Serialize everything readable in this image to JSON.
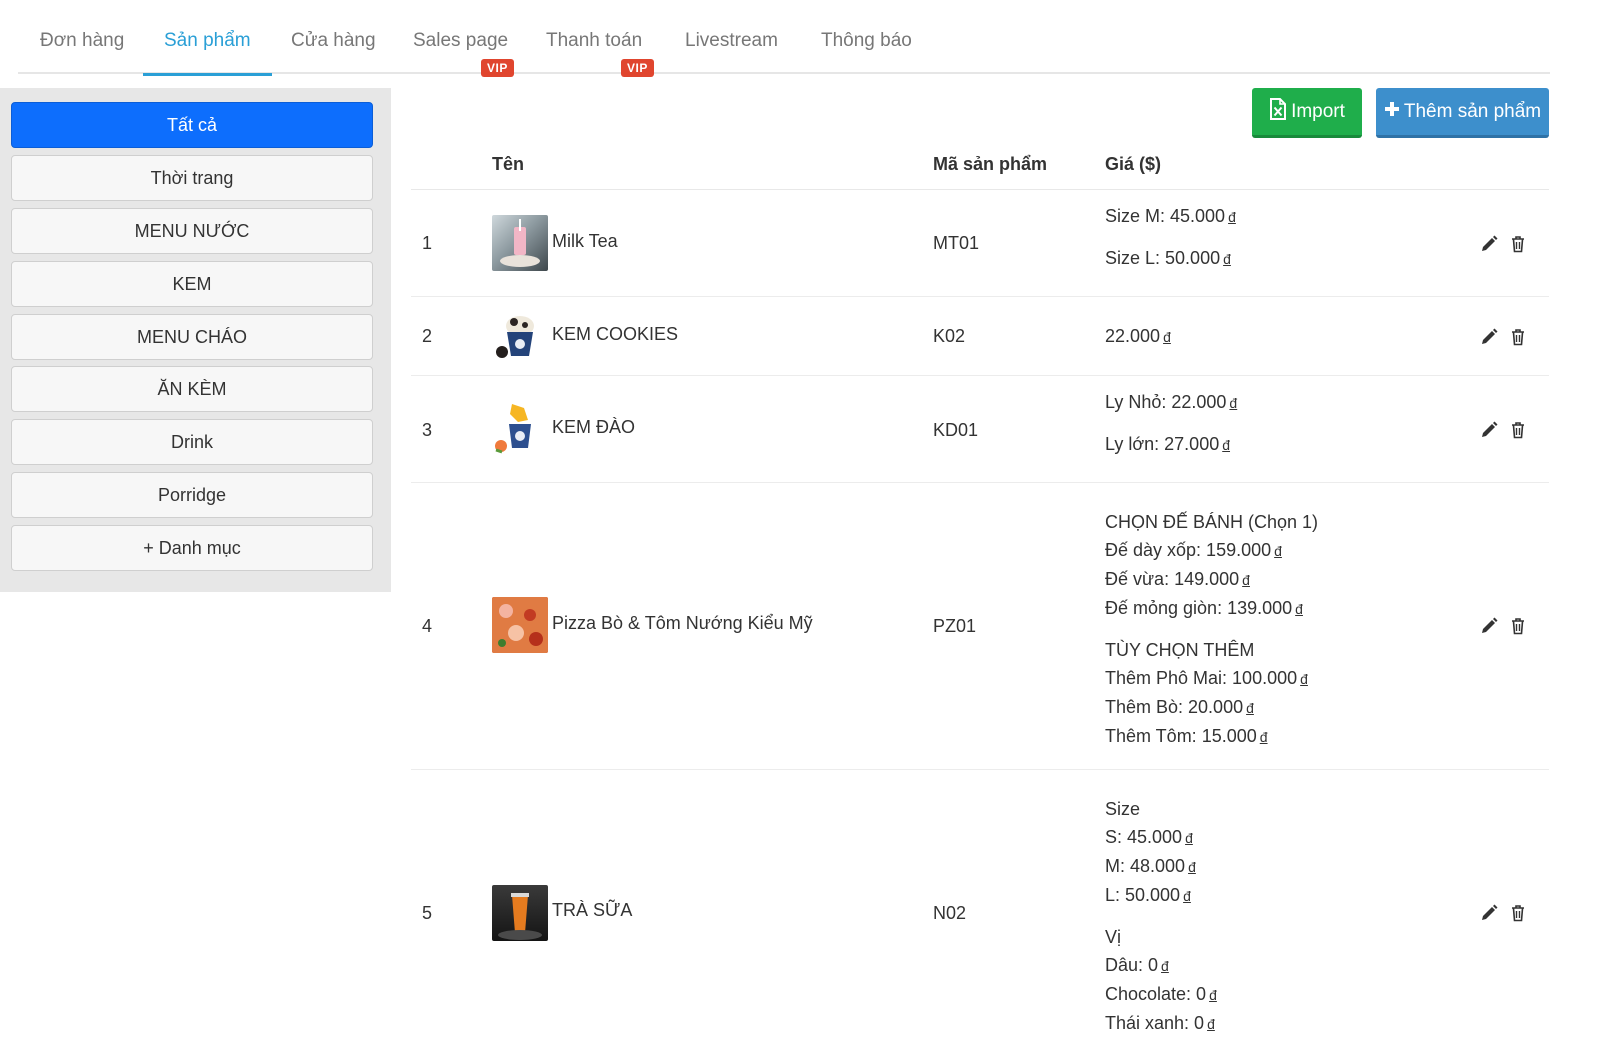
{
  "tabs": [
    {
      "label": "Đơn hàng"
    },
    {
      "label": "Sản phẩm"
    },
    {
      "label": "Cửa hàng"
    },
    {
      "label": "Sales page",
      "badge": "VIP"
    },
    {
      "label": "Thanh toán",
      "badge": "VIP"
    },
    {
      "label": "Livestream"
    },
    {
      "label": "Thông báo"
    }
  ],
  "categories": [
    {
      "label": "Tất cả"
    },
    {
      "label": "Thời trang"
    },
    {
      "label": "MENU NƯỚC"
    },
    {
      "label": "KEM"
    },
    {
      "label": "MENU CHÁO"
    },
    {
      "label": "ĂN KÈM"
    },
    {
      "label": "Drink"
    },
    {
      "label": "Porridge"
    },
    {
      "label": "+ Danh mục"
    }
  ],
  "actions": {
    "import_label": "Import",
    "add_label": "Thêm sản phẩm"
  },
  "table": {
    "headers": {
      "name": "Tên",
      "code": "Mã sản phẩm",
      "price": "Giá ($)"
    },
    "rows": [
      {
        "index": "1",
        "name": "Milk Tea",
        "code": "MT01",
        "prices": [
          [
            "Size M: 45.000 ₫",
            "Size L: 50.000 ₫"
          ]
        ]
      },
      {
        "index": "2",
        "name": "KEM COOKIES",
        "code": "K02",
        "prices": [
          [
            "22.000 ₫"
          ]
        ]
      },
      {
        "index": "3",
        "name": "KEM ĐÀO",
        "code": "KD01",
        "prices": [
          [
            "Ly Nhỏ: 22.000 ₫",
            "Ly lớn: 27.000 ₫"
          ]
        ]
      },
      {
        "index": "4",
        "name": "Pizza Bò & Tôm Nướng Kiểu Mỹ",
        "code": "PZ01",
        "prices": [
          [
            "CHỌN ĐẾ BÁNH (Chọn 1)",
            "Đế dày xốp: 159.000 ₫",
            "Đế vừa: 149.000 ₫",
            "Đế mỏng giòn: 139.000 ₫"
          ],
          [
            "TÙY CHỌN THÊM",
            "Thêm Phô Mai: 100.000 ₫",
            "Thêm Bò: 20.000 ₫",
            "Thêm Tôm: 15.000 ₫"
          ]
        ]
      },
      {
        "index": "5",
        "name": "TRÀ SỮA",
        "code": "N02",
        "prices": [
          [
            "Size",
            "S: 45.000 ₫",
            "M: 48.000 ₫",
            "L: 50.000 ₫"
          ],
          [
            "Vị",
            "Dâu: 0 ₫",
            "Chocolate: 0 ₫",
            "Thái xanh: 0 ₫"
          ]
        ]
      }
    ]
  },
  "colors": {
    "active_tab": "#2a9fd6",
    "vip_badge": "#e0452e",
    "active_category": "#0d6efd",
    "import_button": "#1fae4b",
    "add_button": "#3d8fcc"
  },
  "icons": {
    "import": "excel-file-icon",
    "add": "plus-icon",
    "edit": "pencil-icon",
    "delete": "trash-icon"
  }
}
